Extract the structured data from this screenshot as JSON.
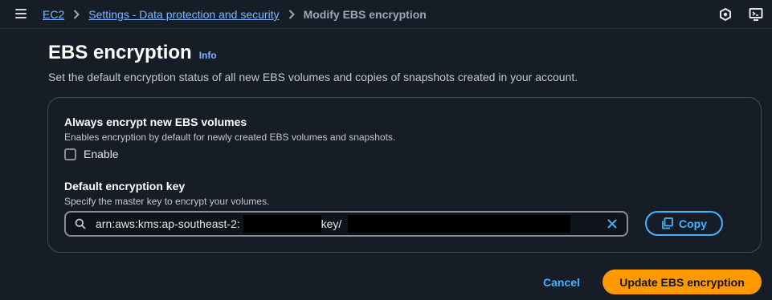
{
  "header": {
    "menu_icon": "hamburger-menu-icon",
    "breadcrumbs": [
      {
        "label": "EC2"
      },
      {
        "label": "Settings - Data protection and security"
      },
      {
        "label": "Modify EBS encryption"
      }
    ],
    "right_icons": [
      "notifications-icon",
      "cloudshell-icon"
    ]
  },
  "page": {
    "title": "EBS encryption",
    "info_label": "Info",
    "description": "Set the default encryption status of all new EBS volumes and copies of snapshots created in your account."
  },
  "encryption": {
    "label": "Always encrypt new EBS volumes",
    "description": "Enables encryption by default for newly created EBS volumes and snapshots.",
    "checkbox_label": "Enable",
    "checked": false
  },
  "default_key": {
    "label": "Default encryption key",
    "description": "Specify the master key to encrypt your volumes.",
    "value_prefix": "arn:aws:kms:ap-southeast-2:",
    "value_middle": ":key/",
    "copy_label": "Copy"
  },
  "actions": {
    "cancel_label": "Cancel",
    "submit_label": "Update EBS encryption"
  },
  "colors": {
    "background": "#161d26",
    "link": "#7cb8ff",
    "accent": "#42b4ff",
    "primary_button": "#ff9900"
  }
}
